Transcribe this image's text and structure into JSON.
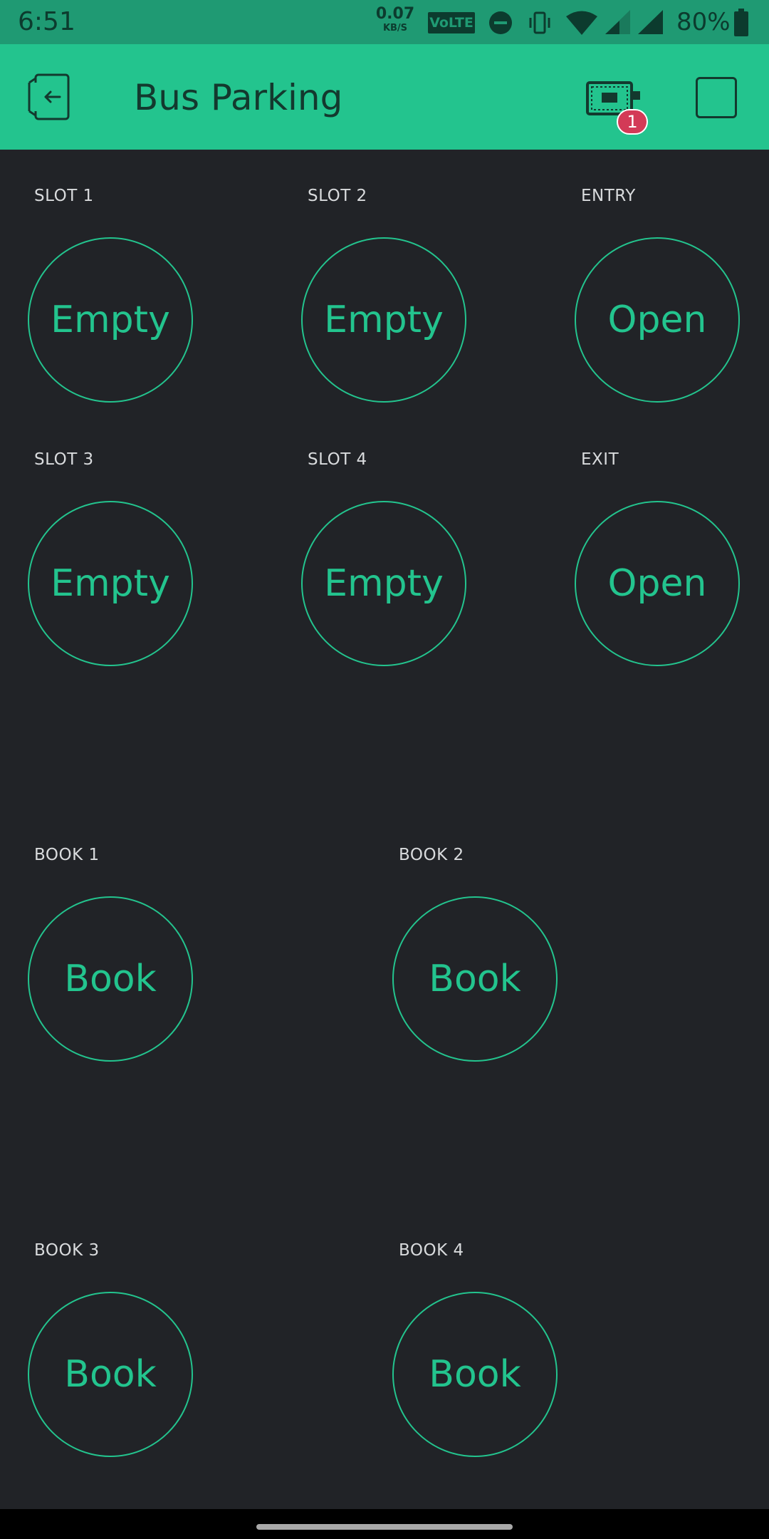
{
  "status_bar": {
    "time": "6:51",
    "net_speed_value": "0.07",
    "net_speed_unit": "KB/S",
    "volte": "VoLTE",
    "battery": "80%",
    "icons": [
      "dnd-icon",
      "vibrate-icon",
      "wifi-icon",
      "signal-icon",
      "signal-icon",
      "battery-icon"
    ]
  },
  "header": {
    "title": "Bus Parking",
    "device_badge_count": "1",
    "icons": [
      "back-icon",
      "device-icon",
      "stop-icon"
    ]
  },
  "widgets": {
    "slot1": {
      "label": "SLOT 1",
      "value": "Empty"
    },
    "slot2": {
      "label": "SLOT 2",
      "value": "Empty"
    },
    "entry": {
      "label": "ENTRY",
      "value": "Open"
    },
    "slot3": {
      "label": "SLOT 3",
      "value": "Empty"
    },
    "slot4": {
      "label": "SLOT 4",
      "value": "Empty"
    },
    "exit": {
      "label": "EXIT",
      "value": "Open"
    },
    "book1": {
      "label": "BOOK 1",
      "value": "Book"
    },
    "book2": {
      "label": "BOOK 2",
      "value": "Book"
    },
    "book3": {
      "label": "BOOK 3",
      "value": "Book"
    },
    "book4": {
      "label": "BOOK 4",
      "value": "Book"
    }
  },
  "colors": {
    "accent": "#23c48e",
    "background": "#212327",
    "status_bar": "#1f9a73",
    "badge": "#d33a57"
  }
}
